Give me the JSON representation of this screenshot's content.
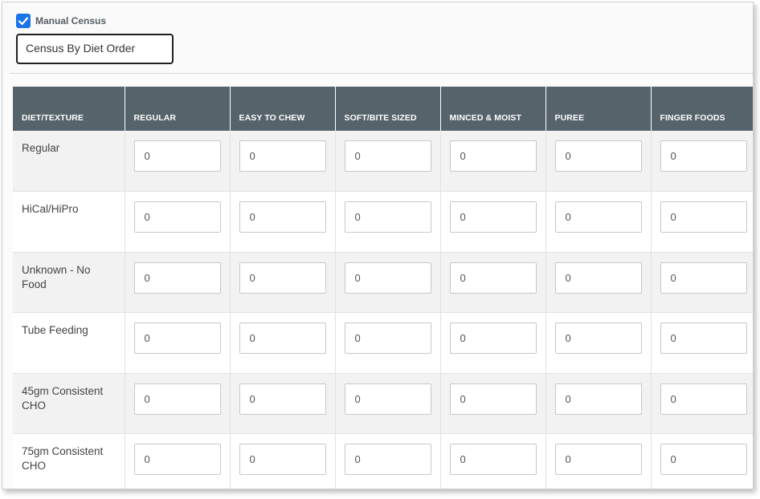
{
  "manual_census": {
    "label": "Manual Census",
    "checked": true
  },
  "census_select": {
    "value": "Census By Diet Order"
  },
  "table": {
    "headers": [
      "DIET/TEXTURE",
      "REGULAR",
      "EASY TO CHEW",
      "SOFT/BITE SIZED",
      "MINCED & MOIST",
      "PUREE",
      "FINGER FOODS"
    ],
    "rows": [
      {
        "diet": "Regular",
        "values": [
          "0",
          "0",
          "0",
          "0",
          "0",
          "0"
        ]
      },
      {
        "diet": "HiCal/HiPro",
        "values": [
          "0",
          "0",
          "0",
          "0",
          "0",
          "0"
        ]
      },
      {
        "diet": "Unknown - No Food",
        "values": [
          "0",
          "0",
          "0",
          "0",
          "0",
          "0"
        ]
      },
      {
        "diet": "Tube Feeding",
        "values": [
          "0",
          "0",
          "0",
          "0",
          "0",
          "0"
        ]
      },
      {
        "diet": "45gm Consistent CHO",
        "values": [
          "0",
          "0",
          "0",
          "0",
          "0",
          "0"
        ]
      },
      {
        "diet": "75gm Consistent CHO",
        "values": [
          "0",
          "0",
          "0",
          "0",
          "0",
          "0"
        ]
      }
    ]
  },
  "colors": {
    "header_bg": "#56636b",
    "checkbox": "#1a73e8",
    "row_alt": "#f2f2f2"
  }
}
